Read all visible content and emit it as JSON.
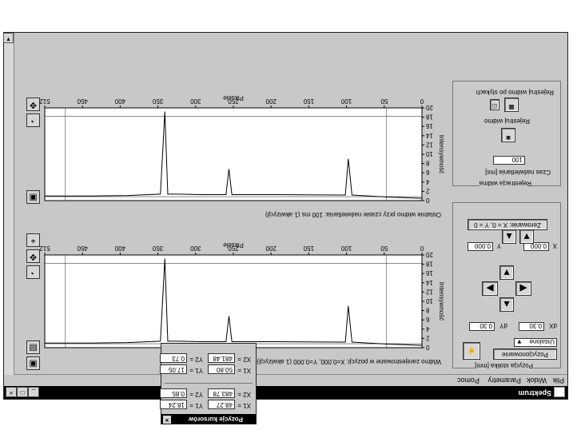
{
  "window": {
    "title": "Spektrum",
    "menu": [
      "Plik",
      "Widok",
      "Parametry",
      "Pomoc"
    ],
    "controls": [
      "_",
      "□",
      "×"
    ]
  },
  "left_panel": {
    "camera_group": {
      "title": "Rejestracja widma",
      "save_label": "Rejestruj widmo po stykach",
      "register_label": "Rejestruj widmo",
      "exposure_label": "Czas naświetlania [ms]",
      "exposure_value": "100"
    },
    "position_group": {
      "title": "Pozycja stolika [mm]",
      "zero_button": "Zerowanie: X = 0, Y = 0",
      "x_label": "X",
      "x_value": "0.000",
      "y_label": "Y",
      "y_value": "0.000",
      "dx_label": "dX",
      "dx_value": "0.30",
      "dy_label": "dY",
      "dy_value": "0.30",
      "mode_button": "Pozycjonowanie",
      "mode_select": "Ustalone"
    }
  },
  "top_chart": {
    "xlabel": "Piksele",
    "ylabel": "Intensywność",
    "caption": "Ostatnie widmo przy czasie naświetlania: 100 ms (1 akwizycji)",
    "chart_data": {
      "type": "line",
      "xlim": [
        0,
        512
      ],
      "ylim": [
        0,
        20
      ],
      "x_ticks": [
        "0",
        "50",
        "100",
        "150",
        "200",
        "250",
        "300",
        "350",
        "400",
        "450",
        "512"
      ],
      "y_ticks": [
        "0",
        "2",
        "4",
        "6",
        "8",
        "10",
        "12",
        "14",
        "16",
        "18",
        "20"
      ],
      "x": [
        0,
        50,
        95,
        100,
        104,
        110,
        200,
        258,
        262,
        266,
        280,
        300,
        330,
        345,
        349,
        355,
        400,
        450,
        512
      ],
      "y": [
        0.5,
        0.8,
        1.2,
        9.0,
        1.2,
        1.2,
        1.3,
        1.3,
        6.8,
        1.3,
        1.3,
        1.3,
        1.4,
        1.4,
        19.2,
        1.4,
        1.1,
        1.0,
        1.0
      ]
    }
  },
  "bottom_chart": {
    "xlabel": "Piksele",
    "ylabel": "Intensywność",
    "caption": "Widmo zarejestrowane w pozycji: X=0.000, Y=0.000 (1 akwizycji)",
    "chart_data": {
      "type": "line",
      "xlim": [
        0,
        512
      ],
      "ylim": [
        0,
        20
      ],
      "x_ticks": [
        "0",
        "50",
        "100",
        "150",
        "200",
        "250",
        "300",
        "350",
        "400",
        "450",
        "512"
      ],
      "y_ticks": [
        "0",
        "2",
        "4",
        "6",
        "8",
        "10",
        "12",
        "14",
        "16",
        "18",
        "20"
      ],
      "x": [
        0,
        50,
        95,
        100,
        104,
        110,
        200,
        258,
        262,
        266,
        280,
        300,
        330,
        345,
        349,
        355,
        400,
        450,
        512
      ],
      "y": [
        0.5,
        0.8,
        1.2,
        9.0,
        1.2,
        1.2,
        1.3,
        1.3,
        6.8,
        1.3,
        1.3,
        1.3,
        1.4,
        1.4,
        19.2,
        1.4,
        1.1,
        1.0,
        1.0
      ]
    }
  },
  "cursor_popup": {
    "title": "Pozycje kursorów",
    "rows_a": [
      {
        "l1": "X1 =",
        "v1": "48.27",
        "l2": "Y1 =",
        "v2": "18.24"
      },
      {
        "l1": "X2 =",
        "v1": "483.78",
        "l2": "Y2 =",
        "v2": "0.85"
      }
    ],
    "rows_b": [
      {
        "l1": "X1 =",
        "v1": "50.80",
        "l2": "Y1 =",
        "v2": "17.05"
      },
      {
        "l1": "X2 =",
        "v1": "481.48",
        "l2": "Y2 =",
        "v2": "0.73"
      }
    ]
  },
  "colors": {
    "titlebar": "#000000",
    "window": "#c8c8c8",
    "plot_bg": "#ffffff",
    "trace": "#000000"
  }
}
